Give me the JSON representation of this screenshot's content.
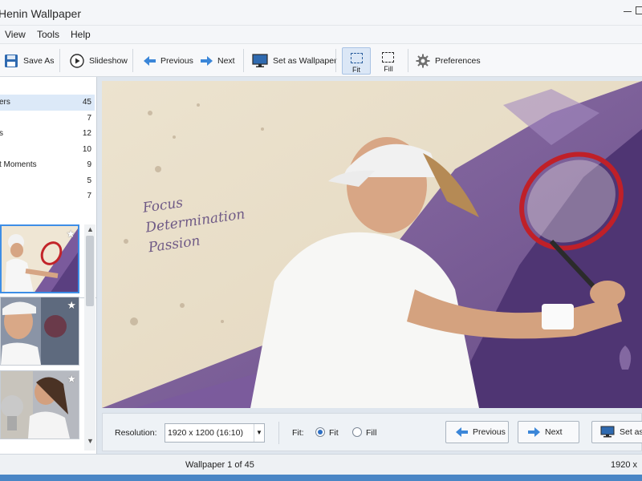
{
  "window": {
    "title": "Henin Wallpaper"
  },
  "menu": [
    "View",
    "Tools",
    "Help"
  ],
  "toolbar": {
    "save_as": "Save As",
    "slideshow": "Slideshow",
    "previous": "Previous",
    "next": "Next",
    "set_wallpaper": "Set as Wallpaper",
    "fit": "Fit",
    "fill": "Fill",
    "preferences": "Preferences",
    "active_mode": "Fit"
  },
  "categories": [
    {
      "name": "ers",
      "count": "45",
      "selected": true
    },
    {
      "name": "",
      "count": "7"
    },
    {
      "name": "s",
      "count": "12"
    },
    {
      "name": "",
      "count": "10"
    },
    {
      "name": "t Moments",
      "count": "9"
    },
    {
      "name": "",
      "count": "5"
    },
    {
      "name": "",
      "count": "7"
    }
  ],
  "image_text": {
    "line1": "Focus",
    "line2": "Determination",
    "line3": "Passion"
  },
  "controls": {
    "resolution_label": "Resolution:",
    "resolution_value": "1920 x 1200 (16:10)",
    "fit_label": "Fit:",
    "fit_option": "Fit",
    "fill_option": "Fill",
    "selected_fit": "Fit",
    "previous": "Previous",
    "next": "Next",
    "set_as": "Set as"
  },
  "status": {
    "position": "Wallpaper 1 of 45",
    "resolution": "1920 x"
  },
  "colors": {
    "accent": "#3b86d8",
    "selection": "#dce9f8",
    "purple_paint": "#6a4a8c",
    "background_paper": "#ebe1cd"
  }
}
